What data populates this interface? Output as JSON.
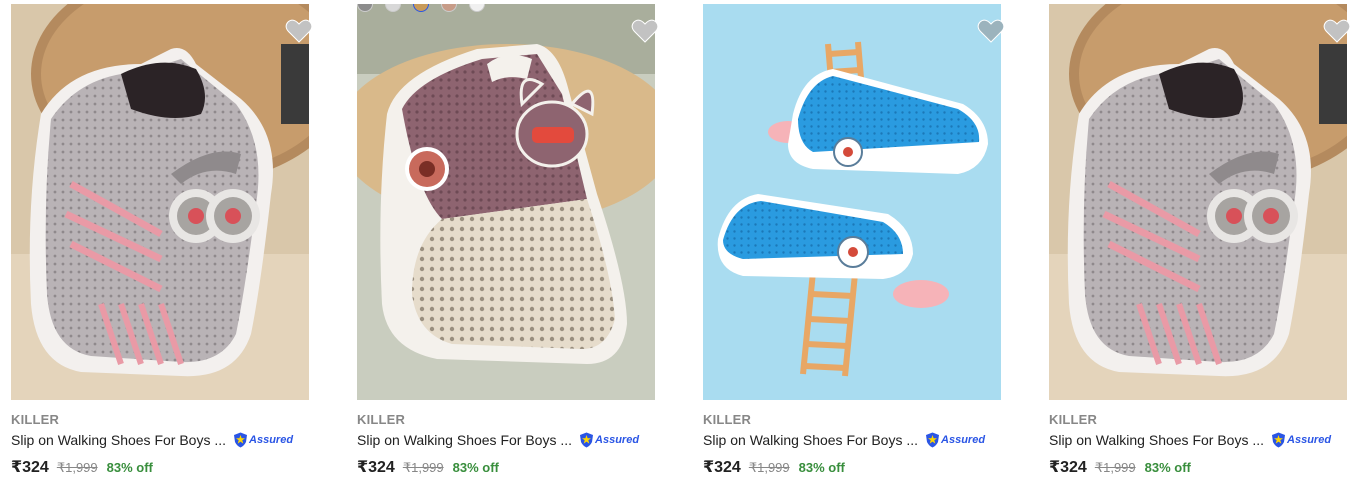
{
  "products": [
    {
      "brand": "KILLER",
      "title": "Slip on Walking Shoes For Boys ...",
      "assured": "Assured",
      "price": "₹324",
      "mrp": "₹1,999",
      "discount": "83% off",
      "image": "grey-pink-knit-shoe-with-eyes"
    },
    {
      "brand": "KILLER",
      "title": "Slip on Walking Shoes For Boys ...",
      "assured": "Assured",
      "price": "₹324",
      "mrp": "₹1,999",
      "discount": "83% off",
      "image": "maroon-cream-knit-shoe-with-bunny"
    },
    {
      "brand": "KILLER",
      "title": "Slip on Walking Shoes For Boys ...",
      "assured": "Assured",
      "price": "₹324",
      "mrp": "₹1,999",
      "discount": "83% off",
      "image": "blue-knit-shoes-with-ladders"
    },
    {
      "brand": "KILLER",
      "title": "Slip on Walking Shoes For Boys ...",
      "assured": "Assured",
      "price": "₹324",
      "mrp": "₹1,999",
      "discount": "83% off",
      "image": "grey-pink-knit-shoe-with-eyes"
    }
  ],
  "icons": {
    "wishlist": "heart-icon",
    "assured": "assured-shield-icon"
  },
  "colors": {
    "price_green": "#388e3c",
    "assured_blue": "#2a55e5",
    "muted": "#878787"
  }
}
